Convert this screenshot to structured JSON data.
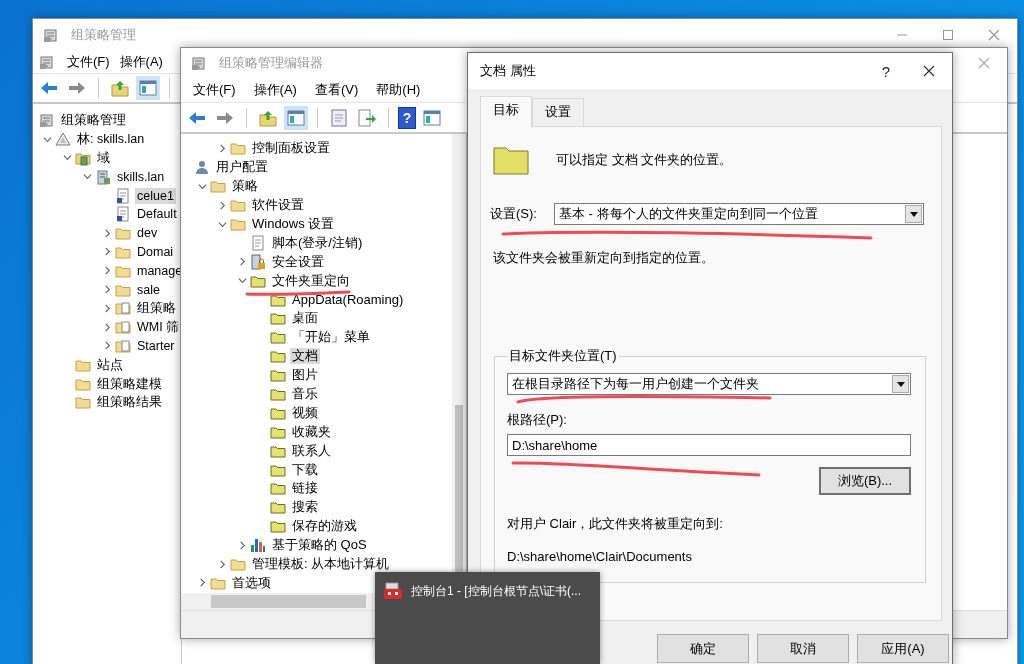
{
  "gpmc": {
    "title": "组策略管理",
    "menu": [
      "文件(F)",
      "操作(A)"
    ],
    "tree": [
      {
        "label": "组策略管理",
        "kind": "gpmc",
        "selected": false,
        "children": [
          {
            "label": "林: skills.lan",
            "kind": "forest",
            "expanded": true,
            "selected": false,
            "children": [
              {
                "label": "域",
                "kind": "domains",
                "expanded": true,
                "selected": false,
                "children": [
                  {
                    "label": "skills.lan",
                    "kind": "domain",
                    "expanded": true,
                    "selected": false,
                    "children": [
                      {
                        "label": "celue1",
                        "kind": "gpo",
                        "selected": true
                      },
                      {
                        "label": "Default",
                        "kind": "gpo",
                        "selected": false
                      },
                      {
                        "label": "dev",
                        "kind": "ou",
                        "expanded": false,
                        "selected": false
                      },
                      {
                        "label": "Domai",
                        "kind": "ou",
                        "expanded": false,
                        "selected": false
                      },
                      {
                        "label": "manage",
                        "kind": "ou",
                        "expanded": false,
                        "selected": false
                      },
                      {
                        "label": "sale",
                        "kind": "ou",
                        "expanded": false,
                        "selected": false
                      },
                      {
                        "label": "组策略",
                        "kind": "gpo-folder",
                        "expanded": false,
                        "selected": false
                      },
                      {
                        "label": "WMI 筛",
                        "kind": "wmi",
                        "expanded": false,
                        "selected": false
                      },
                      {
                        "label": "Starter",
                        "kind": "gpo-folder",
                        "expanded": false,
                        "selected": false
                      }
                    ]
                  }
                ]
              },
              {
                "label": "站点",
                "kind": "sites",
                "selected": false
              },
              {
                "label": "组策略建模",
                "kind": "modeling",
                "selected": false
              },
              {
                "label": "组策略结果",
                "kind": "results",
                "selected": false
              }
            ]
          }
        ]
      }
    ]
  },
  "editor": {
    "title": "组策略管理编辑器",
    "menu": [
      "文件(F)",
      "操作(A)",
      "查看(V)",
      "帮助(H)"
    ],
    "help_glyph": "?",
    "tree_top": [
      {
        "label": "控制面板设置",
        "kind": "cpanel",
        "expanded": false,
        "selected": false
      }
    ],
    "tree": [
      {
        "label": "用户配置",
        "kind": "user",
        "selected": false,
        "children": [
          {
            "label": "策略",
            "kind": "folder",
            "expanded": true,
            "selected": false,
            "children": [
              {
                "label": "软件设置",
                "kind": "folder",
                "expanded": false,
                "selected": false
              },
              {
                "label": "Windows 设置",
                "kind": "folder",
                "expanded": true,
                "selected": false,
                "children": [
                  {
                    "label": "脚本(登录/注销)",
                    "kind": "script",
                    "selected": false
                  },
                  {
                    "label": "安全设置",
                    "kind": "security",
                    "expanded": false,
                    "selected": false
                  },
                  {
                    "label": "文件夹重定向",
                    "kind": "redirect",
                    "expanded": true,
                    "selected": false,
                    "children": [
                      {
                        "label": "AppData(Roaming)",
                        "kind": "redirect",
                        "selected": false
                      },
                      {
                        "label": "桌面",
                        "kind": "redirect",
                        "selected": false
                      },
                      {
                        "label": "「开始」菜单",
                        "kind": "redirect",
                        "selected": false
                      },
                      {
                        "label": "文档",
                        "kind": "redirect",
                        "selected": true
                      },
                      {
                        "label": "图片",
                        "kind": "redirect",
                        "selected": false
                      },
                      {
                        "label": "音乐",
                        "kind": "redirect",
                        "selected": false
                      },
                      {
                        "label": "视频",
                        "kind": "redirect",
                        "selected": false
                      },
                      {
                        "label": "收藏夹",
                        "kind": "redirect",
                        "selected": false
                      },
                      {
                        "label": "联系人",
                        "kind": "redirect",
                        "selected": false
                      },
                      {
                        "label": "下载",
                        "kind": "redirect",
                        "selected": false
                      },
                      {
                        "label": "链接",
                        "kind": "redirect",
                        "selected": false
                      },
                      {
                        "label": "搜索",
                        "kind": "redirect",
                        "selected": false
                      },
                      {
                        "label": "保存的游戏",
                        "kind": "redirect",
                        "selected": false
                      }
                    ]
                  },
                  {
                    "label": "基于策略的 QoS",
                    "kind": "qos",
                    "expanded": false,
                    "selected": false
                  }
                ]
              },
              {
                "label": "管理模板: 从本地计算机",
                "kind": "folder",
                "expanded": false,
                "selected": false
              }
            ]
          },
          {
            "label": "首选项",
            "kind": "folder",
            "expanded": false,
            "selected": false
          }
        ]
      }
    ]
  },
  "dialog": {
    "title": "文档 属性",
    "help": "?",
    "tabs": [
      {
        "label": "目标",
        "selected": true
      },
      {
        "label": "设置",
        "selected": false
      }
    ],
    "intro": "可以指定 文档 文件夹的位置。",
    "setting_label": "设置(S):",
    "setting_value": "基本 - 将每个人的文件夹重定向到同一个位置",
    "setting_note": "该文件夹会被重新定向到指定的位置。",
    "target_group": {
      "legend": "目标文件夹位置(T)",
      "option": "在根目录路径下为每一用户创建一个文件夹",
      "root_label": "根路径(P):",
      "root_path": "D:\\share\\home",
      "browse": "浏览(B)...",
      "preview_label": "对用户 Clair，此文件夹将被重定向到:",
      "preview_path": "D:\\share\\home\\Clair\\Documents"
    },
    "buttons": [
      "确定",
      "取消",
      "应用(A)"
    ]
  },
  "taskbar_preview": {
    "title": "控制台1 - [控制台根节点\\证书(..."
  }
}
